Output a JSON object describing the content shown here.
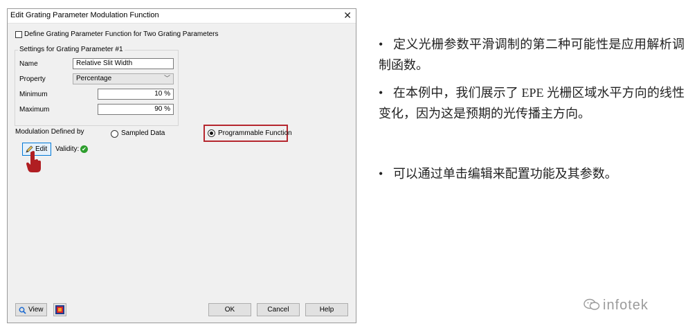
{
  "dialog": {
    "title": "Edit Grating Parameter Modulation Function",
    "close_glyph": "✕",
    "two_params_checkbox_label": "Define Grating Parameter Function for Two Grating Parameters",
    "group_title": "Settings for Grating Parameter #1",
    "name_label": "Name",
    "name_value": "Relative Slit Width",
    "property_label": "Property",
    "property_value": "Percentage",
    "minimum_label": "Minimum",
    "minimum_value": "10 %",
    "maximum_label": "Maximum",
    "maximum_value": "90 %",
    "modulation_label": "Modulation Defined by",
    "sampled_data_label": "Sampled Data",
    "programmable_function_label": "Programmable Function",
    "selected_mode": "Programmable Function",
    "edit_label": "Edit",
    "validity_label": "Validity:",
    "view_label": "View",
    "ok_label": "OK",
    "cancel_label": "Cancel",
    "help_label": "Help"
  },
  "colors": {
    "highlight": "#b5262e",
    "valid": "#2e9e2e",
    "pointer": "#b01e22"
  },
  "icons": [
    "pencil-icon",
    "checkmark-icon",
    "hand-pointer-icon",
    "magnifier-icon",
    "image-icon",
    "wechat-icon"
  ],
  "notes": {
    "bullet": "•",
    "p1": "定义光栅参数平滑调制的第二种可能性是应用解析调制函数。",
    "p2": "在本例中，我们展示了 EPE 光栅区域水平方向的线性变化，因为这是预期的光传播主方向。",
    "p3": "可以通过单击编辑来配置功能及其参数。"
  },
  "watermark": "infotek"
}
